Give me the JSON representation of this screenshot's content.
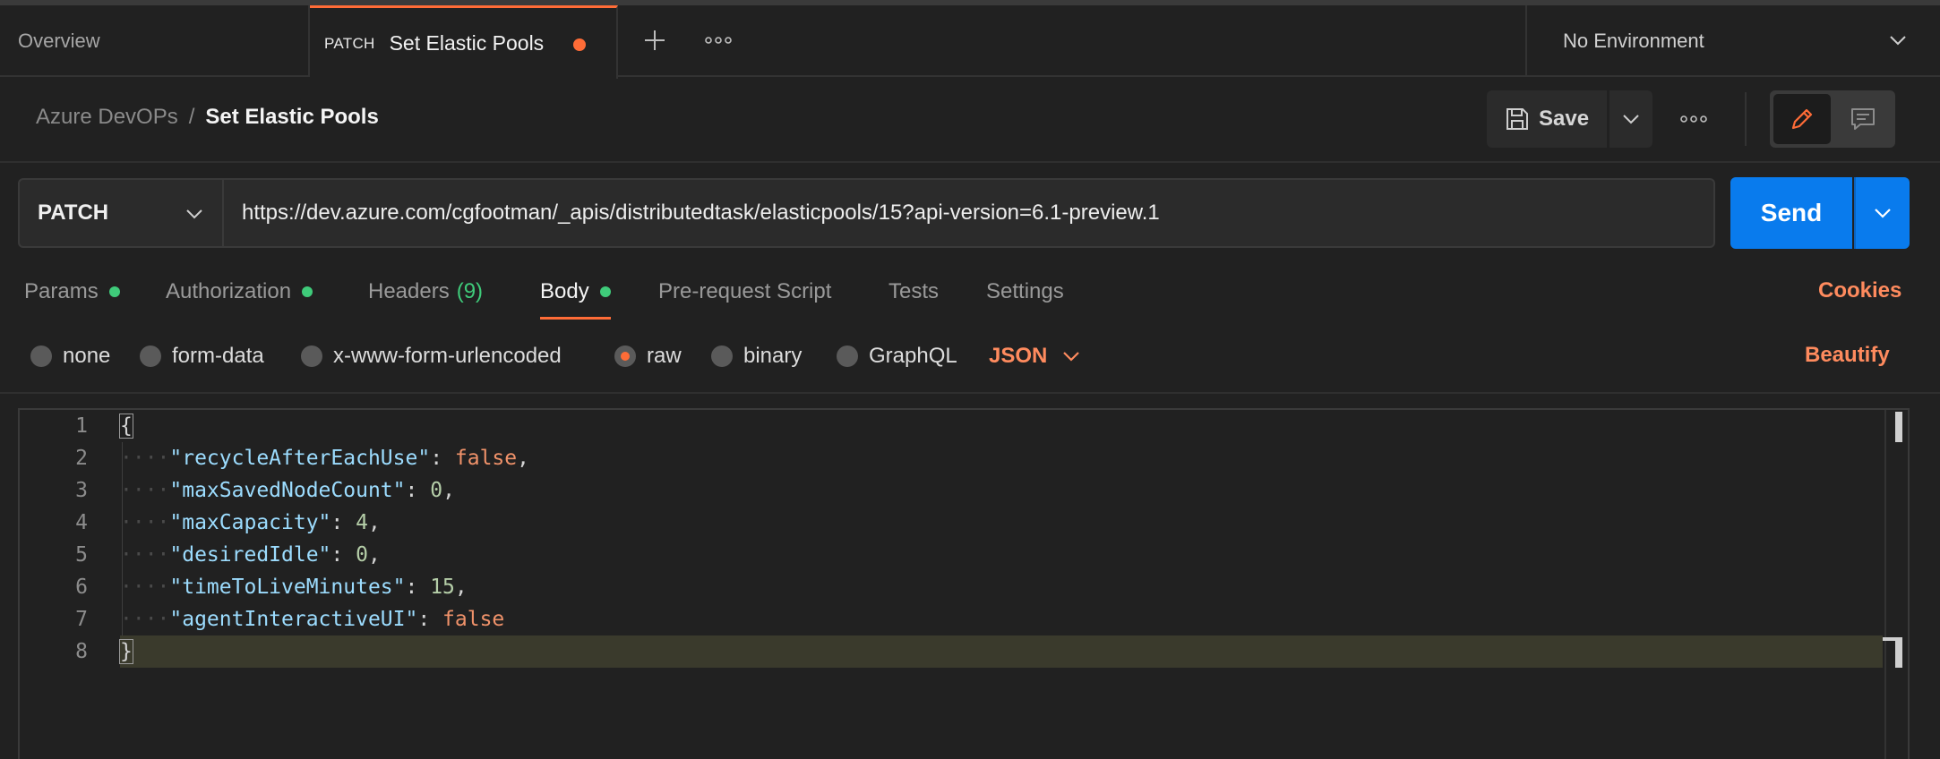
{
  "tabs": {
    "overview_label": "Overview",
    "active": {
      "method": "PATCH",
      "title": "Set Elastic Pools"
    }
  },
  "environment": {
    "selected": "No Environment"
  },
  "breadcrumb": {
    "collection": "Azure DevOPs",
    "separator": "/",
    "request": "Set Elastic Pools"
  },
  "toolbar": {
    "save_label": "Save"
  },
  "request": {
    "method": "PATCH",
    "url": "https://dev.azure.com/cgfootman/_apis/distributedtask/elasticpools/15?api-version=6.1-preview.1",
    "send_label": "Send"
  },
  "request_tabs": [
    {
      "label": "Params",
      "dot": true
    },
    {
      "label": "Authorization",
      "dot": true
    },
    {
      "label": "Headers",
      "count": "(9)"
    },
    {
      "label": "Body",
      "dot": true,
      "active": true
    },
    {
      "label": "Pre-request Script"
    },
    {
      "label": "Tests"
    },
    {
      "label": "Settings"
    }
  ],
  "cookies_label": "Cookies",
  "body_types": [
    {
      "label": "none",
      "selected": false
    },
    {
      "label": "form-data",
      "selected": false
    },
    {
      "label": "x-www-form-urlencoded",
      "selected": false
    },
    {
      "label": "raw",
      "selected": true
    },
    {
      "label": "binary",
      "selected": false
    },
    {
      "label": "GraphQL",
      "selected": false
    }
  ],
  "body_language": "JSON",
  "beautify_label": "Beautify",
  "editor": {
    "line_numbers": [
      "1",
      "2",
      "3",
      "4",
      "5",
      "6",
      "7",
      "8"
    ],
    "open_brace": "{",
    "close_brace": "}",
    "fields": [
      {
        "key": "\"recycleAfterEachUse\"",
        "value": "false",
        "type": "bool",
        "trail": ","
      },
      {
        "key": "\"maxSavedNodeCount\"",
        "value": "0",
        "type": "num",
        "trail": ","
      },
      {
        "key": "\"maxCapacity\"",
        "value": "4",
        "type": "num",
        "trail": ","
      },
      {
        "key": "\"desiredIdle\"",
        "value": "0",
        "type": "num",
        "trail": ","
      },
      {
        "key": "\"timeToLiveMinutes\"",
        "value": "15",
        "type": "num",
        "trail": ","
      },
      {
        "key": "\"agentInteractiveUI\"",
        "value": "false",
        "type": "bool",
        "trail": ""
      }
    ]
  },
  "colors": {
    "accent": "#ff6c37",
    "send": "#097bed",
    "status_dot": "#3fcb7a",
    "background": "#212121"
  }
}
